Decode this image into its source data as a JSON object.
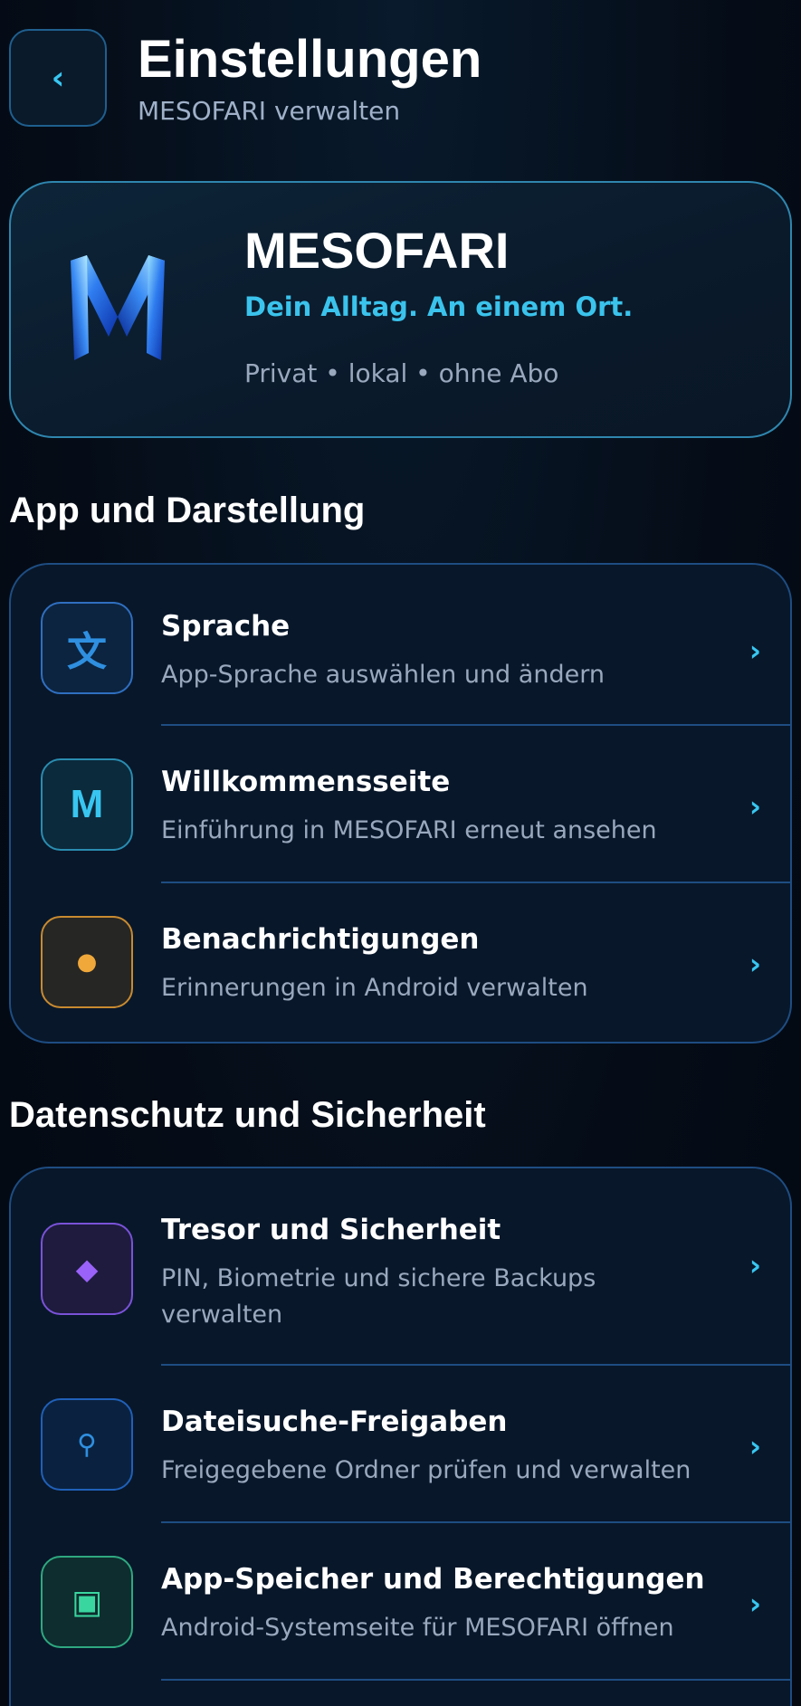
{
  "header": {
    "back_glyph": "‹",
    "title": "Einstellungen",
    "subtitle": "MESOFARI verwalten"
  },
  "hero": {
    "app_name": "MESOFARI",
    "tagline": "Dein Alltag. An einem Ort.",
    "meta": "Privat • lokal • ohne Abo",
    "logo_icon": "mesofari-logo"
  },
  "sections": [
    {
      "title": "App und Darstellung",
      "items": [
        {
          "title": "Sprache",
          "description": "App-Sprache auswählen und ändern",
          "icon": "translate-icon",
          "glyph": "文",
          "accent": "#2f8fe0"
        },
        {
          "title": "Willkommensseite",
          "description": "Einführung in MESOFARI erneut ansehen",
          "icon": "welcome-m-icon",
          "glyph": "M",
          "accent": "#38c6f0"
        },
        {
          "title": "Benachrichtigungen",
          "description": "Erinnerungen in Android verwalten",
          "icon": "notification-dot-icon",
          "glyph": "●",
          "accent": "#f0a83a"
        }
      ]
    },
    {
      "title": "Datenschutz und Sicherheit",
      "items": [
        {
          "title": "Tresor und Sicherheit",
          "description": "PIN, Biometrie und sichere Backups verwalten",
          "icon": "diamond-icon",
          "glyph": "◆",
          "accent": "#8a5cf0"
        },
        {
          "title": "Dateisuche-Freigaben",
          "description": "Freigegebene Ordner prüfen und verwalten",
          "icon": "search-icon",
          "glyph": "⚲",
          "accent": "#2f8fe0"
        },
        {
          "title": "App-Speicher und Berechtigungen",
          "description": "Android-Systemseite für MESOFARI öffnen",
          "icon": "storage-icon",
          "glyph": "▣",
          "accent": "#3ad6a0"
        }
      ]
    }
  ],
  "chevron_glyph": "›",
  "colors": {
    "background": "#050c17",
    "accent": "#38c6f0",
    "card_border": "#1e4d82"
  }
}
